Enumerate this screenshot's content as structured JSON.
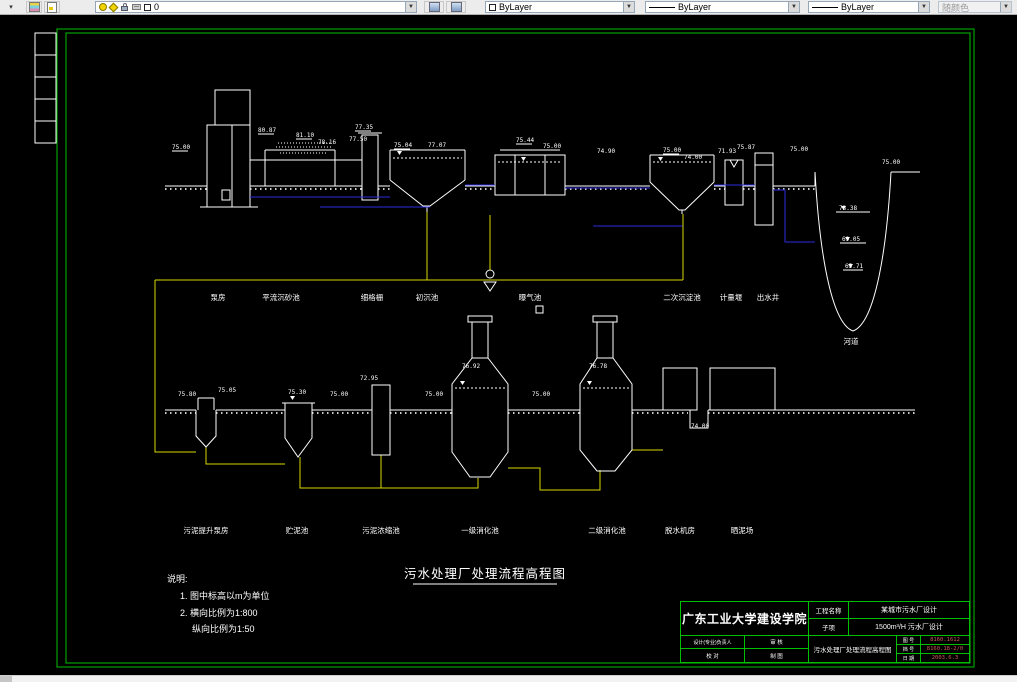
{
  "toolbar": {
    "flyout_arrow": "▾",
    "layer_value": "0",
    "color_value": "ByLayer",
    "linetype_value": "ByLayer",
    "lineweight_value": "ByLayer",
    "plotstyle_value": "随颜色"
  },
  "canvas": {
    "title": "污水处理厂处理流程高程图",
    "notes": {
      "heading": "说明:",
      "line1": "1. 图中标高以m为单位",
      "line2": "2. 横向比例为1:800",
      "line3": "纵向比例为1:50"
    },
    "river_label": "河道",
    "process_labels_top": [
      "泵房",
      "平流沉砂池",
      "细格栅",
      "初沉池",
      "曝气池",
      "二次沉淀池",
      "计量堰",
      "出水井"
    ],
    "process_labels_bottom": [
      "污泥提升泵房",
      "贮泥池",
      "污泥浓缩池",
      "一级消化池",
      "二级消化池",
      "脱水机房",
      "晒泥场"
    ],
    "elevations_top": [
      "75.00",
      "80.87",
      "81.10",
      "78.16",
      "77.35",
      "77.50",
      "75.04",
      "77.07",
      "75.44",
      "75.00",
      "74.90",
      "75.00",
      "74.00",
      "71.93",
      "75.87",
      "75.00",
      "75.00"
    ],
    "elevations_river": [
      "73.38",
      "69.05",
      "65.71"
    ],
    "elevations_bottom": [
      "75.80",
      "75.05",
      "75.30",
      "75.00",
      "72.95",
      "75.00",
      "76.92",
      "75.00",
      "76.78",
      "74.00"
    ]
  },
  "titleblock": {
    "university": "广东工业大学建设学院",
    "project_label": "工程名称",
    "project_value": "某城市污水厂设计",
    "sub_label": "子项",
    "sub_value": "1500m³/H 污水厂设计",
    "drawing_name": "污水处理厂处理流程高程图",
    "design_label": "设计(专业)负责人",
    "check_label": "审 核",
    "proof_label": "校 对",
    "draft_label": "制 图",
    "no_label": "图 号",
    "no_value": "8160.1612",
    "file_label": "档 号",
    "file_value": "8160.18-2/0",
    "date_label": "日 期",
    "date_value": "2003.6.3"
  }
}
